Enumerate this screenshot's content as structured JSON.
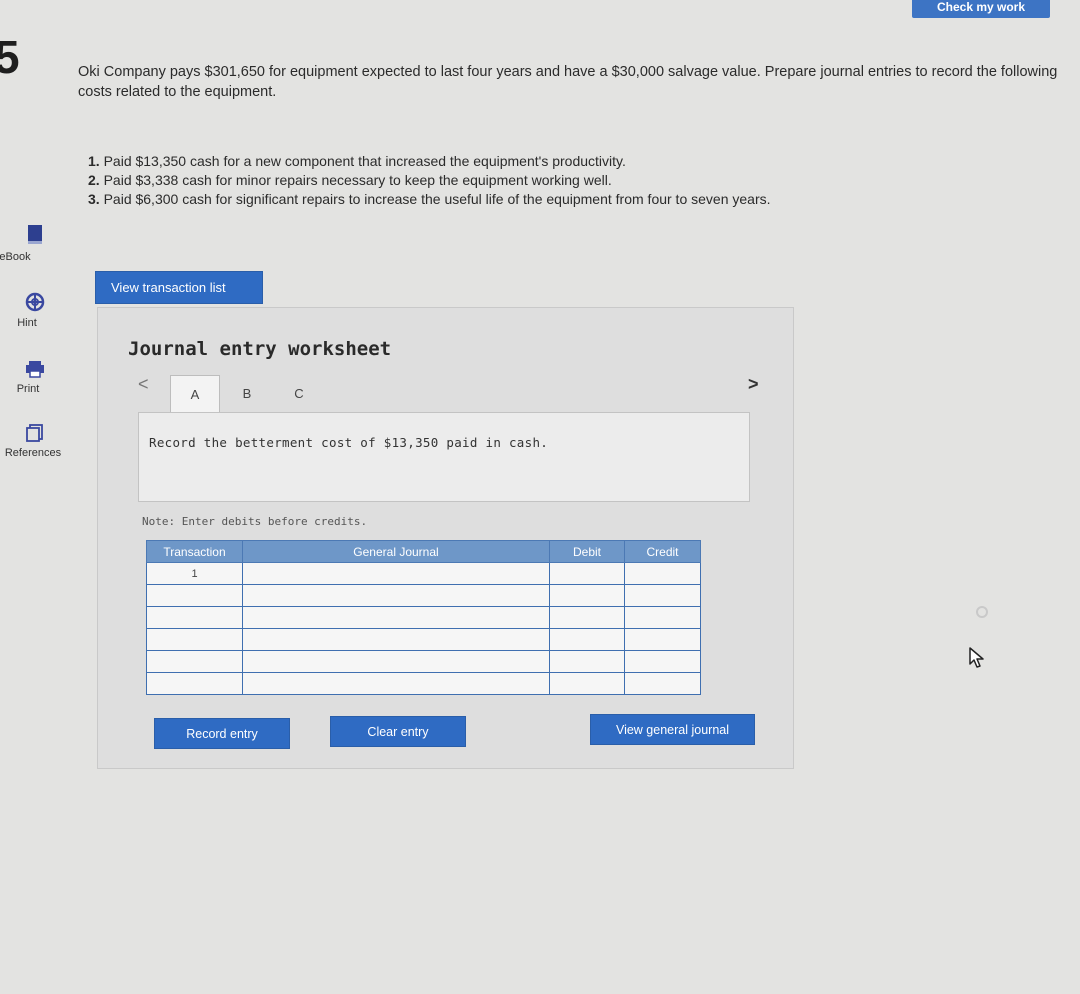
{
  "header": {
    "top_button_label": "Check my work"
  },
  "question": {
    "number": "5",
    "intro": "Oki Company pays $301,650 for equipment expected to last four years and have a $30,000 salvage value. Prepare journal entries to record the following costs related to the equipment.",
    "items": [
      {
        "num": "1.",
        "text": "Paid $13,350 cash for a new component that increased the equipment's productivity."
      },
      {
        "num": "2.",
        "text": "Paid $3,338 cash for minor repairs necessary to keep the equipment working well."
      },
      {
        "num": "3.",
        "text": "Paid $6,300 cash for significant repairs to increase the useful life of the equipment from four to seven years."
      }
    ]
  },
  "sidebar": {
    "items": [
      {
        "label": "eBook",
        "icon": "book-icon"
      },
      {
        "label": "Hint",
        "icon": "hint-icon"
      },
      {
        "label": "Print",
        "icon": "print-icon"
      },
      {
        "label": "References",
        "icon": "references-icon"
      }
    ]
  },
  "buttons": {
    "view_transaction_list": "View transaction list",
    "record_entry": "Record entry",
    "clear_entry": "Clear entry",
    "view_general_journal": "View general journal"
  },
  "worksheet": {
    "title": "Journal entry worksheet",
    "nav_prev": "<",
    "nav_next": ">",
    "tabs": [
      "A",
      "B",
      "C"
    ],
    "active_tab": "A",
    "instruction": "Record the betterment cost of $13,350 paid in cash.",
    "note": "Note: Enter debits before credits.",
    "table": {
      "headers": [
        "Transaction",
        "General Journal",
        "Debit",
        "Credit"
      ],
      "rows": [
        [
          "1",
          "",
          "",
          ""
        ],
        [
          "",
          "",
          "",
          ""
        ],
        [
          "",
          "",
          "",
          ""
        ],
        [
          "",
          "",
          "",
          ""
        ],
        [
          "",
          "",
          "",
          ""
        ],
        [
          "",
          "",
          "",
          ""
        ]
      ]
    }
  },
  "colors": {
    "accent": "#2f6bc3",
    "table_header": "#6e97c8",
    "background": "#e3e3e1"
  }
}
